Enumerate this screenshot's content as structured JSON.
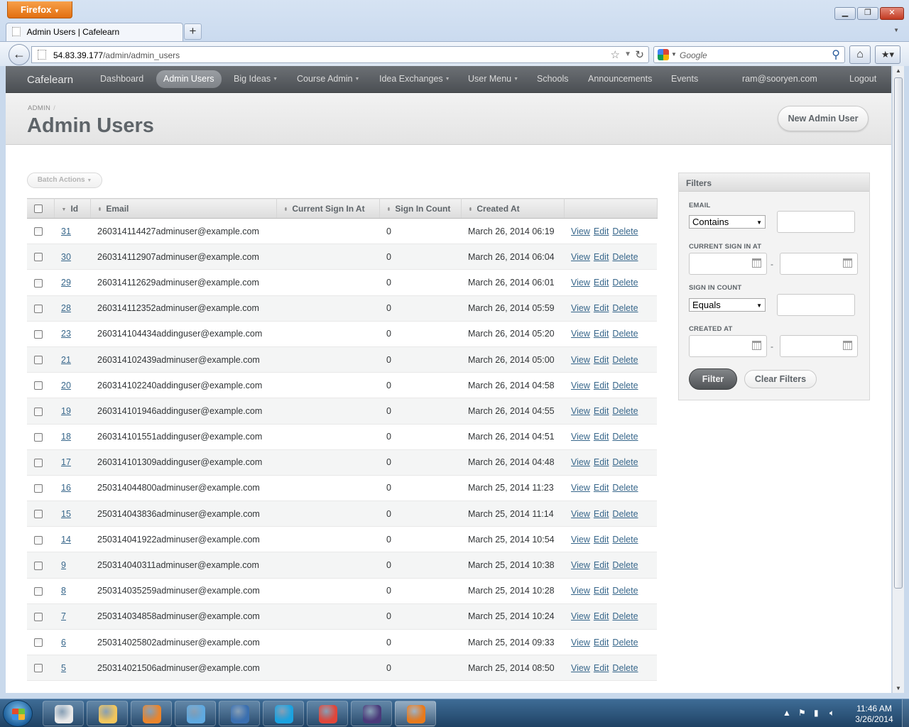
{
  "browser": {
    "app_button": "Firefox",
    "tab_title": "Admin Users | Cafelearn",
    "url_host": "54.83.39.177",
    "url_path": "/admin/admin_users",
    "search_placeholder": "Google"
  },
  "site": {
    "title": "Cafelearn",
    "nav": [
      {
        "label": "Dashboard",
        "caret": false,
        "current": false
      },
      {
        "label": "Admin Users",
        "caret": false,
        "current": true
      },
      {
        "label": "Big Ideas",
        "caret": true,
        "current": false
      },
      {
        "label": "Course Admin",
        "caret": true,
        "current": false
      },
      {
        "label": "Idea Exchanges",
        "caret": true,
        "current": false
      },
      {
        "label": "User Menu",
        "caret": true,
        "current": false
      },
      {
        "label": "Schools",
        "caret": false,
        "current": false
      },
      {
        "label": "Announcements",
        "caret": false,
        "current": false
      },
      {
        "label": "Events",
        "caret": false,
        "current": false
      },
      {
        "label": "ram@sooryen.com",
        "caret": false,
        "current": false
      },
      {
        "label": "Logout",
        "caret": false,
        "current": false
      }
    ]
  },
  "page": {
    "breadcrumb": "ADMIN",
    "breadcrumb_sep": "/",
    "title": "Admin Users",
    "new_button": "New Admin User",
    "batch_actions": "Batch Actions"
  },
  "table": {
    "columns": [
      "Id",
      "Email",
      "Current Sign In At",
      "Sign In Count",
      "Created At"
    ],
    "actions": {
      "view": "View",
      "edit": "Edit",
      "delete": "Delete"
    },
    "rows": [
      {
        "id": "31",
        "email": "260314114427adminuser@example.com",
        "current_sign_in_at": "",
        "sign_in_count": "0",
        "created_at": "March 26, 2014 06:19"
      },
      {
        "id": "30",
        "email": "260314112907adminuser@example.com",
        "current_sign_in_at": "",
        "sign_in_count": "0",
        "created_at": "March 26, 2014 06:04"
      },
      {
        "id": "29",
        "email": "260314112629adminuser@example.com",
        "current_sign_in_at": "",
        "sign_in_count": "0",
        "created_at": "March 26, 2014 06:01"
      },
      {
        "id": "28",
        "email": "260314112352adminuser@example.com",
        "current_sign_in_at": "",
        "sign_in_count": "0",
        "created_at": "March 26, 2014 05:59"
      },
      {
        "id": "23",
        "email": "260314104434addinguser@example.com",
        "current_sign_in_at": "",
        "sign_in_count": "0",
        "created_at": "March 26, 2014 05:20"
      },
      {
        "id": "21",
        "email": "260314102439adminuser@example.com",
        "current_sign_in_at": "",
        "sign_in_count": "0",
        "created_at": "March 26, 2014 05:00"
      },
      {
        "id": "20",
        "email": "260314102240addinguser@example.com",
        "current_sign_in_at": "",
        "sign_in_count": "0",
        "created_at": "March 26, 2014 04:58"
      },
      {
        "id": "19",
        "email": "260314101946addinguser@example.com",
        "current_sign_in_at": "",
        "sign_in_count": "0",
        "created_at": "March 26, 2014 04:55"
      },
      {
        "id": "18",
        "email": "260314101551addinguser@example.com",
        "current_sign_in_at": "",
        "sign_in_count": "0",
        "created_at": "March 26, 2014 04:51"
      },
      {
        "id": "17",
        "email": "260314101309addinguser@example.com",
        "current_sign_in_at": "",
        "sign_in_count": "0",
        "created_at": "March 26, 2014 04:48"
      },
      {
        "id": "16",
        "email": "250314044800adminuser@example.com",
        "current_sign_in_at": "",
        "sign_in_count": "0",
        "created_at": "March 25, 2014 11:23"
      },
      {
        "id": "15",
        "email": "250314043836adminuser@example.com",
        "current_sign_in_at": "",
        "sign_in_count": "0",
        "created_at": "March 25, 2014 11:14"
      },
      {
        "id": "14",
        "email": "250314041922adminuser@example.com",
        "current_sign_in_at": "",
        "sign_in_count": "0",
        "created_at": "March 25, 2014 10:54"
      },
      {
        "id": "9",
        "email": "250314040311adminuser@example.com",
        "current_sign_in_at": "",
        "sign_in_count": "0",
        "created_at": "March 25, 2014 10:38"
      },
      {
        "id": "8",
        "email": "250314035259adminuser@example.com",
        "current_sign_in_at": "",
        "sign_in_count": "0",
        "created_at": "March 25, 2014 10:28"
      },
      {
        "id": "7",
        "email": "250314034858adminuser@example.com",
        "current_sign_in_at": "",
        "sign_in_count": "0",
        "created_at": "March 25, 2014 10:24"
      },
      {
        "id": "6",
        "email": "250314025802adminuser@example.com",
        "current_sign_in_at": "",
        "sign_in_count": "0",
        "created_at": "March 25, 2014 09:33"
      },
      {
        "id": "5",
        "email": "250314021506adminuser@example.com",
        "current_sign_in_at": "",
        "sign_in_count": "0",
        "created_at": "March 25, 2014 08:50"
      }
    ]
  },
  "filters": {
    "title": "Filters",
    "email_label": "EMAIL",
    "email_operator": "Contains",
    "current_sign_in_label": "CURRENT SIGN IN AT",
    "sign_in_count_label": "SIGN IN COUNT",
    "sign_in_count_operator": "Equals",
    "created_at_label": "CREATED AT",
    "range_sep": "-",
    "filter_button": "Filter",
    "clear_button": "Clear Filters"
  },
  "taskbar": {
    "time": "11:46 AM",
    "date": "3/26/2014",
    "apps": [
      "notepad-icon",
      "explorer-icon",
      "media-player-icon",
      "safari-icon",
      "thunderbird-icon",
      "skype-icon",
      "chrome-icon",
      "eclipse-icon",
      "firefox-icon"
    ]
  },
  "colors": {
    "header_bg": "#5b5f63",
    "title_text": "#5e6469",
    "link": "#38678b",
    "firefox_orange": "#e87a1c"
  }
}
